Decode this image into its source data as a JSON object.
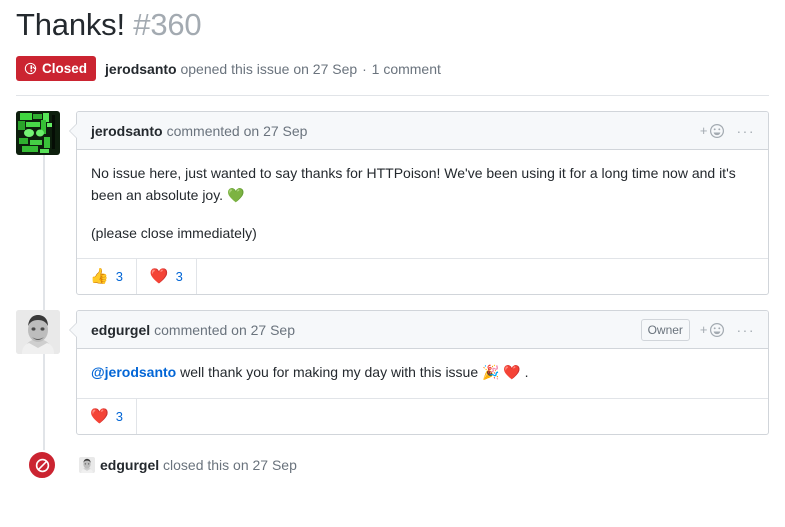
{
  "issue": {
    "title": "Thanks!",
    "number": "#360",
    "state_label": "Closed",
    "state_color": "#cb2431",
    "meta_author": "jerodsanto",
    "meta_action": "opened this issue on 27 Sep",
    "meta_separator": "·",
    "meta_comments": "1 comment"
  },
  "comments": [
    {
      "author": "jerodsanto",
      "action": "commented on 27 Sep",
      "badge": null,
      "add_reaction_label": "+",
      "kebab_label": "···",
      "paragraphs": [
        "No issue here, just wanted to say thanks for HTTPoison! We've been using it for a long time now and it's been an absolute joy. 💚",
        "(please close immediately)"
      ],
      "reactions": [
        {
          "emoji": "👍",
          "name": "thumbs-up",
          "count": "3"
        },
        {
          "emoji": "❤️",
          "name": "heart",
          "count": "3"
        }
      ]
    },
    {
      "author": "edgurgel",
      "action": "commented on 27 Sep",
      "badge": "Owner",
      "add_reaction_label": "+",
      "kebab_label": "···",
      "mention": "@jerodsanto",
      "body_rest": " well thank you for making my day with this issue 🎉 ❤️ .",
      "reactions": [
        {
          "emoji": "❤️",
          "name": "heart",
          "count": "3"
        }
      ]
    }
  ],
  "closed_event": {
    "icon": "issue-closed-icon",
    "actor": "edgurgel",
    "text": "closed this on 27 Sep"
  }
}
